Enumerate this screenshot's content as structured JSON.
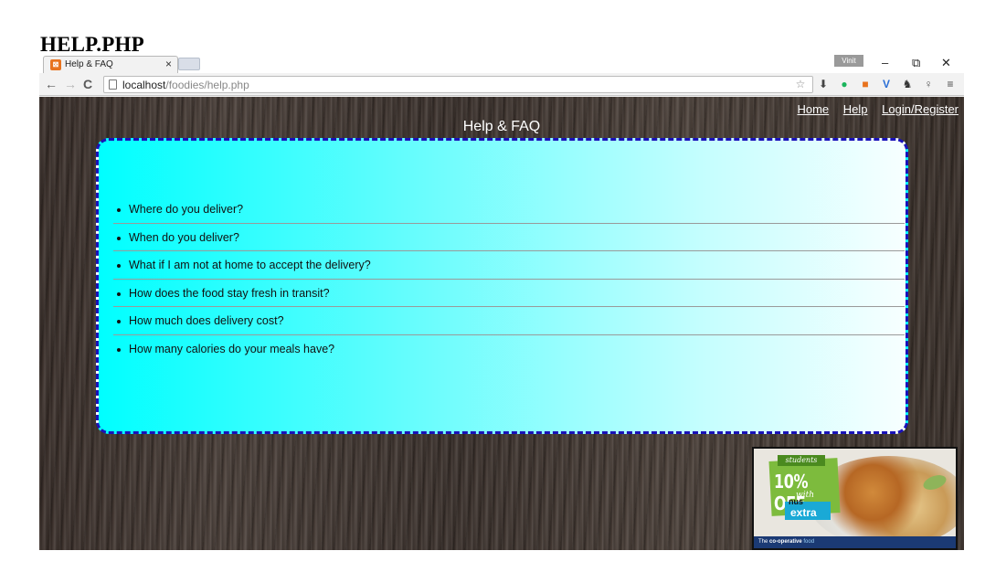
{
  "doc_heading": "HELP.PHP",
  "browser": {
    "tab": {
      "title": "Help & FAQ",
      "close": "×"
    },
    "user_badge": "Vinit",
    "window_controls": {
      "minimize": "–",
      "restore": "⧉",
      "close": "✕"
    },
    "toolbar": {
      "back": "←",
      "forward": "→",
      "reload": "C",
      "url_host": "localhost",
      "url_path": "/foodies/help.php"
    },
    "extension_icons": [
      "star-icon",
      "download-icon",
      "green-circle-icon",
      "orange-icon",
      "vivaldi-icon",
      "ghost-icon",
      "lightbulb-icon",
      "menu-icon"
    ]
  },
  "page": {
    "nav": [
      {
        "label": "Home"
      },
      {
        "label": "Help"
      },
      {
        "label": "Login/Register"
      }
    ],
    "title": "Help & FAQ",
    "faq": [
      "Where do you deliver?",
      "When do you deliver?",
      "What if I am not at home to accept the delivery?",
      "How does the food stay fresh in transit?",
      "How much does delivery cost?",
      "How many calories do your meals have?"
    ],
    "ad": {
      "students": "students",
      "offer": "10% OFF",
      "with": "with",
      "nus": "nus",
      "extra": "extra",
      "brand_prefix": "The ",
      "brand_bold": "co-operative",
      "brand_food": " food"
    }
  },
  "colors": {
    "panel_border": "#1a12b8",
    "panel_gradient_start": "#00ffff",
    "panel_gradient_end": "#f7ffff",
    "wood": "#3f342e"
  }
}
